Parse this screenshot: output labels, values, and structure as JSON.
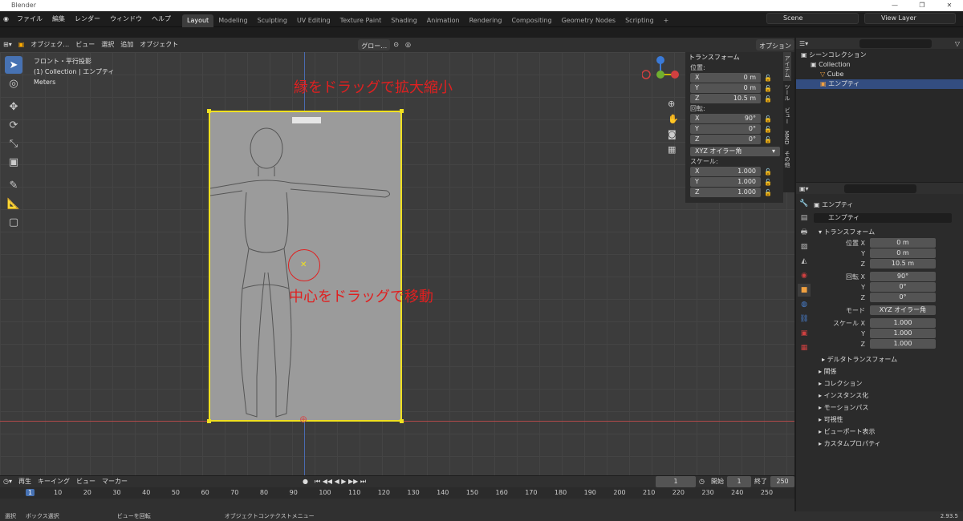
{
  "app": {
    "title": "Blender",
    "version": "2.93.5"
  },
  "menu": [
    "ファイル",
    "編集",
    "レンダー",
    "ウィンドウ",
    "ヘルプ"
  ],
  "workspaces": [
    "Layout",
    "Modeling",
    "Sculpting",
    "UV Editing",
    "Texture Paint",
    "Shading",
    "Animation",
    "Rendering",
    "Compositing",
    "Geometry Nodes",
    "Scripting"
  ],
  "scene": "Scene",
  "view_layer": "View Layer",
  "vp_header": {
    "mode": "オブジェク…",
    "view": "ビュー",
    "select": "選択",
    "add": "追加",
    "object": "オブジェクト",
    "global": "グロー…",
    "options": "オプション"
  },
  "view_info": {
    "line1": "フロント・平行投影",
    "line2": "(1) Collection | エンプティ",
    "line3": "Meters"
  },
  "annotations": {
    "top": "縁をドラッグで拡大縮小",
    "center": "中心をドラッグで移動"
  },
  "npanel": {
    "header": "トランスフォーム",
    "location": "位置:",
    "rotation": "回転:",
    "scale": "スケール:",
    "loc": [
      {
        "a": "X",
        "v": "0 m"
      },
      {
        "a": "Y",
        "v": "0 m"
      },
      {
        "a": "Z",
        "v": "10.5 m"
      }
    ],
    "rot": [
      {
        "a": "X",
        "v": "90°"
      },
      {
        "a": "Y",
        "v": "0°"
      },
      {
        "a": "Z",
        "v": "0°"
      }
    ],
    "mode": "XYZ オイラー角",
    "scl": [
      {
        "a": "X",
        "v": "1.000"
      },
      {
        "a": "Y",
        "v": "1.000"
      },
      {
        "a": "Z",
        "v": "1.000"
      }
    ]
  },
  "vtabs": [
    "アイテム",
    "ツール",
    "ビュー",
    "MMD",
    "その他"
  ],
  "outliner": {
    "root": "シーンコレクション",
    "collection": "Collection",
    "cube": "Cube",
    "empty": "エンプティ"
  },
  "props": {
    "object_name": "エンプティ",
    "name_field": "エンプティ",
    "transform": "トランスフォーム",
    "loc_label": "位置 X",
    "rot_label": "回転 X",
    "mode_label": "モード",
    "scale_label": "スケール X",
    "loc": [
      "0 m",
      "0 m",
      "10.5 m"
    ],
    "rot": [
      "90°",
      "0°",
      "0°"
    ],
    "mode": "XYZ オイラー角",
    "scl": [
      "1.000",
      "1.000",
      "1.000"
    ],
    "sections": [
      "デルタトランスフォーム",
      "関係",
      "コレクション",
      "インスタンス化",
      "モーションパス",
      "可視性",
      "ビューポート表示",
      "カスタムプロパティ"
    ]
  },
  "timeline": {
    "play": "再生",
    "keying": "キーイング",
    "view": "ビュー",
    "marker": "マーカー",
    "current": "1",
    "start_label": "開始",
    "start": "1",
    "end_label": "終了",
    "end": "250",
    "ticks": [
      "1",
      "10",
      "20",
      "30",
      "40",
      "50",
      "60",
      "70",
      "80",
      "90",
      "100",
      "110",
      "120",
      "130",
      "140",
      "150",
      "160",
      "170",
      "180",
      "190",
      "200",
      "210",
      "220",
      "230",
      "240",
      "250"
    ]
  },
  "status": {
    "select": "選択",
    "box": "ボックス選択",
    "rotate": "ビューを回転",
    "context": "オブジェクトコンテクストメニュー"
  }
}
